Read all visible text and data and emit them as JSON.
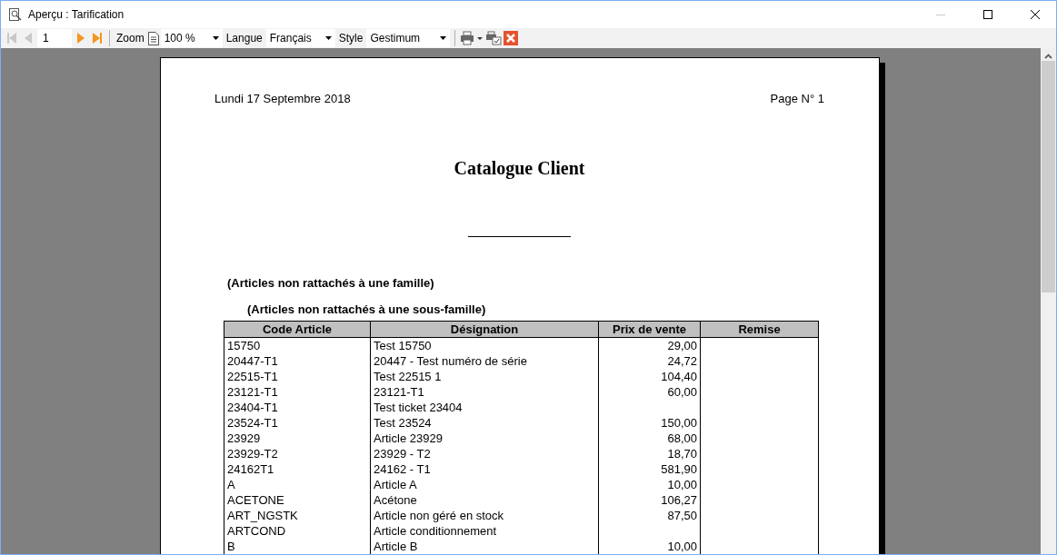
{
  "window": {
    "title": "Aperçu : Tarification",
    "minimize_disabled": true
  },
  "toolbar": {
    "first_disabled": true,
    "prev_disabled": true,
    "page": "1",
    "next_disabled": false,
    "last_disabled": false,
    "zoom_label": "Zoom",
    "zoom": "100 %",
    "language_label": "Langue",
    "language": "Français",
    "style_label": "Style",
    "style": "Gestimum"
  },
  "page": {
    "date": "Lundi 17 Septembre 2018",
    "page_number": "Page N° 1",
    "title": "Catalogue Client",
    "family": "(Articles non rattachés à une famille)",
    "subfamily": "(Articles non rattachés à une sous-famille)",
    "table": {
      "columns": [
        "Code Article",
        "Désignation",
        "Prix de vente",
        "Remise"
      ],
      "rows": [
        [
          "15750",
          "Test 15750",
          "29,00"
        ],
        [
          "20447-T1",
          "20447 - Test numéro de série",
          "24,72"
        ],
        [
          "22515-T1",
          "Test 22515 1",
          "104,40"
        ],
        [
          "23121-T1",
          "23121-T1",
          "60,00"
        ],
        [
          "23404-T1",
          "Test ticket 23404",
          ""
        ],
        [
          "23524-T1",
          "Test 23524",
          "150,00"
        ],
        [
          "23929",
          "Article 23929",
          "68,00"
        ],
        [
          "23929-T2",
          "23929 - T2",
          "18,70"
        ],
        [
          "24162T1",
          "24162 - T1",
          "581,90"
        ],
        [
          "A",
          "Article A",
          "10,00"
        ],
        [
          "ACETONE",
          "Acétone",
          "106,27"
        ],
        [
          "ART_NGSTK",
          "Article non géré en stock",
          "87,50"
        ],
        [
          "ARTCOND",
          "Article conditionnement",
          ""
        ],
        [
          "B",
          "Article B",
          "10,00"
        ]
      ]
    }
  }
}
